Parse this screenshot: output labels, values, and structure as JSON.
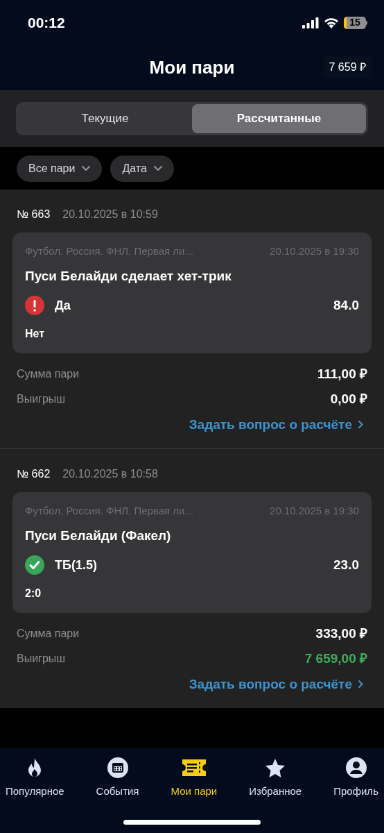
{
  "status_bar": {
    "time": "00:12",
    "battery": "15"
  },
  "header": {
    "title": "Мои пари",
    "balance": "7 659 ₽"
  },
  "segments": [
    {
      "label": "Текущие",
      "selected": false
    },
    {
      "label": "Рассчитанные",
      "selected": true
    }
  ],
  "filters": [
    "Все пари",
    "Дата"
  ],
  "bets": [
    {
      "number": "№ 663",
      "placed": "20.10.2025 в 10:59",
      "league": "Футбол. Россия. ФНЛ. Первая ли...",
      "event_time": "20.10.2025 в 19:30",
      "market": "Пуси Белайди сделает хет-трик",
      "kind": "lost",
      "outcome": "Да",
      "odds": "84.0",
      "score": "Нет",
      "stake_label": "Сумма пари",
      "stake": "111,00 ₽",
      "win_label": "Выигрыш",
      "win": "0,00 ₽",
      "link": "Задать вопрос о расчёте"
    },
    {
      "number": "№ 662",
      "placed": "20.10.2025 в 10:58",
      "league": "Футбол. Россия. ФНЛ. Первая ли...",
      "event_time": "20.10.2025 в 19:30",
      "market": "Пуси Белайди (Факел)",
      "kind": "won",
      "outcome": "ТБ(1.5)",
      "odds": "23.0",
      "score": "2:0",
      "stake_label": "Сумма пари",
      "stake": "333,00 ₽",
      "win_label": "Выигрыш",
      "win": "7 659,00 ₽",
      "link": "Задать вопрос о расчёте"
    }
  ],
  "tab_bar": [
    {
      "label": "Популярное",
      "kind": "flame",
      "selected": false
    },
    {
      "label": "События",
      "kind": "calendar",
      "selected": false
    },
    {
      "label": "Мои пари",
      "kind": "ticket",
      "selected": true
    },
    {
      "label": "Избранное",
      "kind": "star",
      "selected": false
    },
    {
      "label": "Профиль",
      "kind": "profile",
      "selected": false
    }
  ]
}
